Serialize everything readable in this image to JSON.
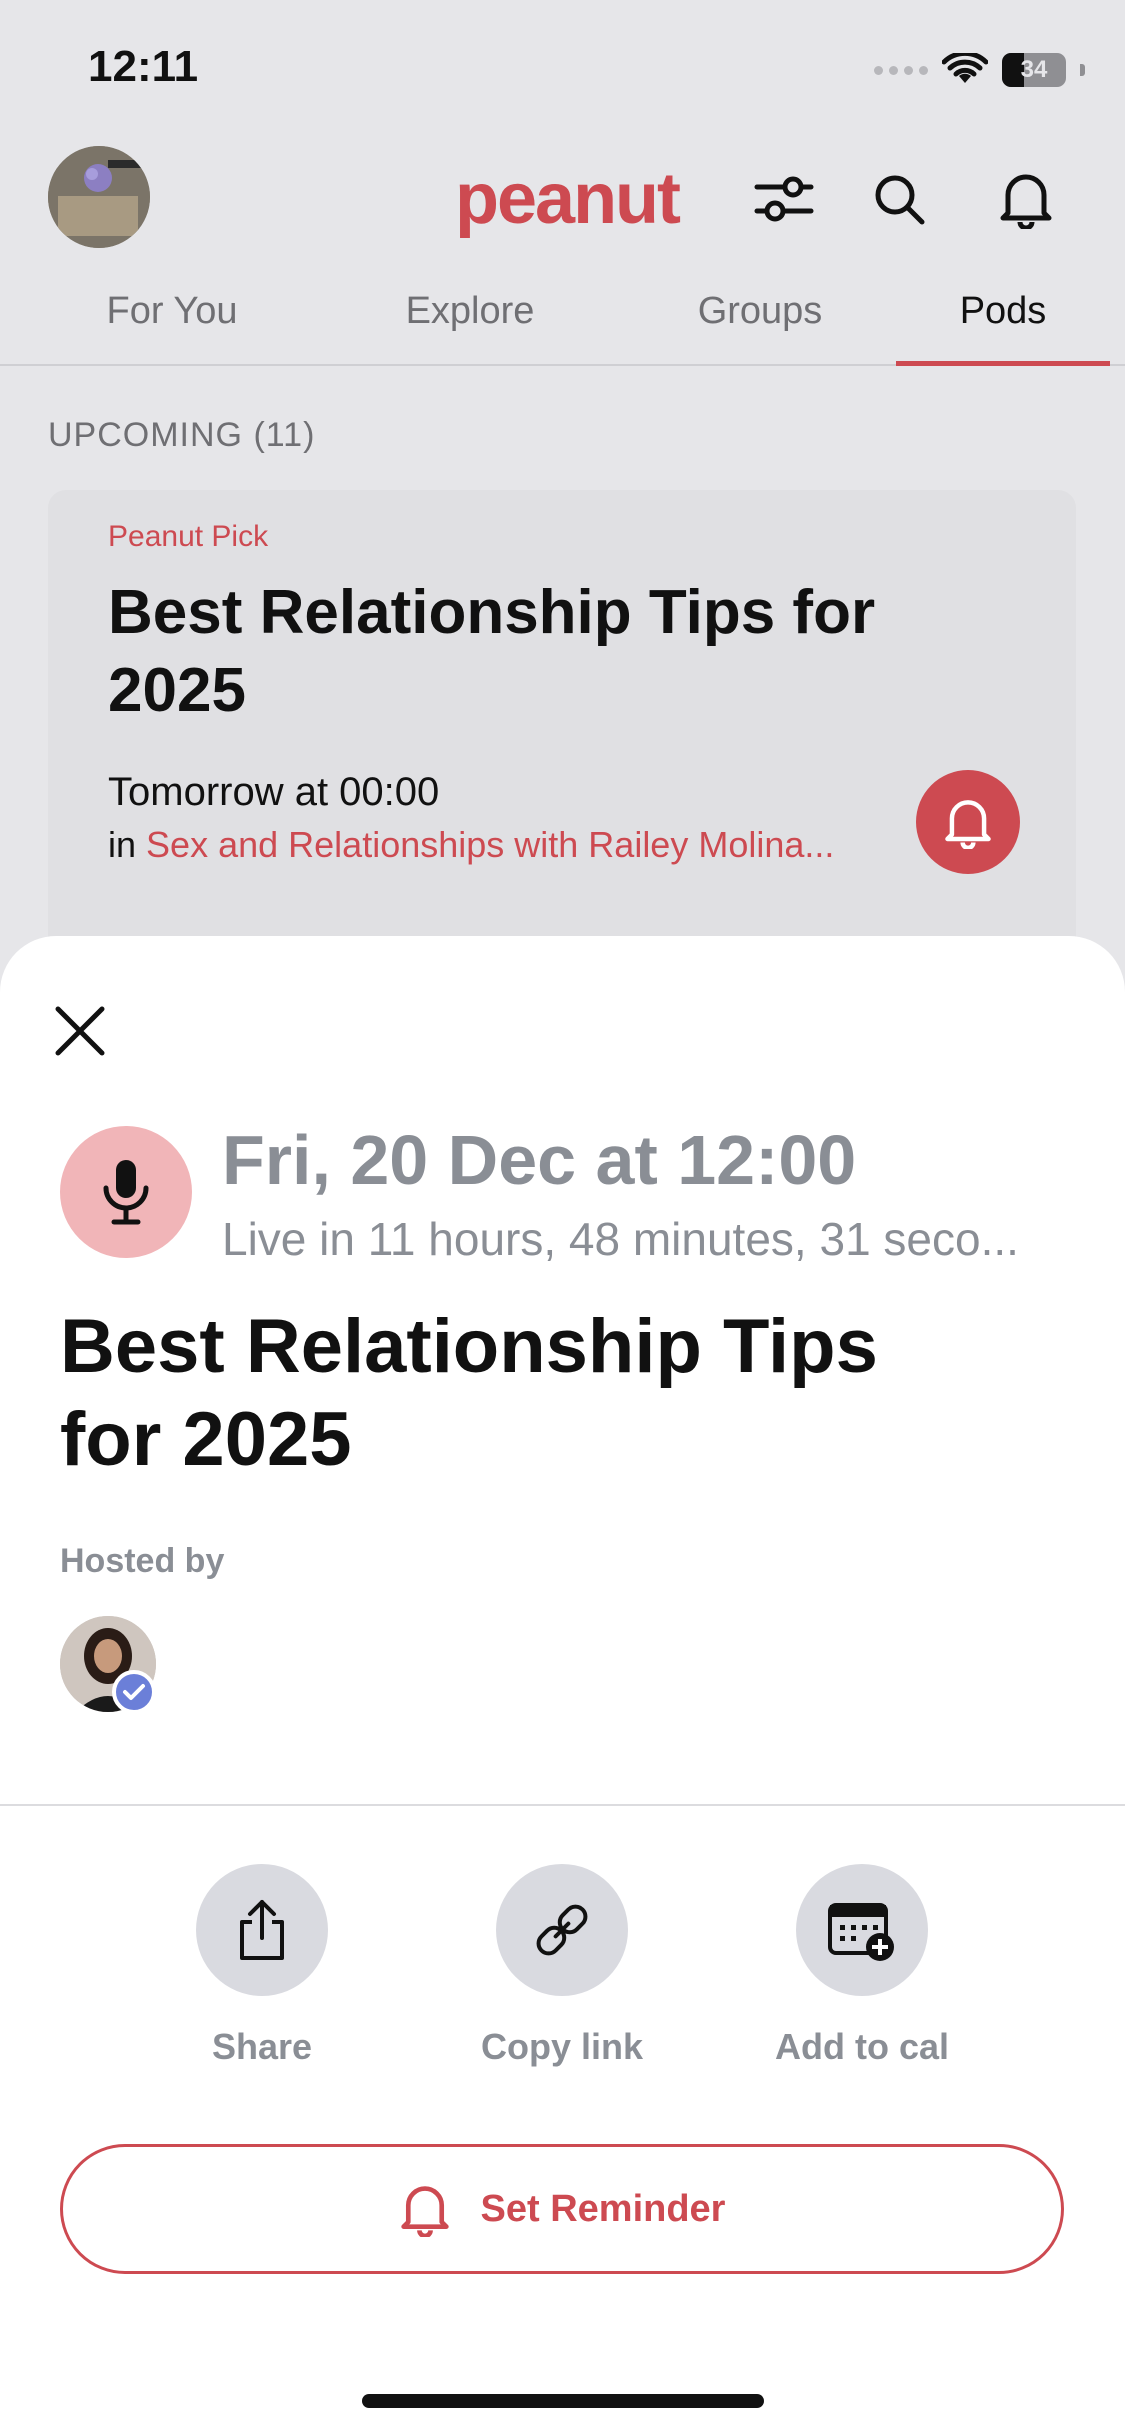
{
  "status_bar": {
    "time": "12:11",
    "battery": "34"
  },
  "header": {
    "logo": "peanut",
    "icons": [
      "filter-icon",
      "search-icon",
      "bell-icon"
    ]
  },
  "tabs": [
    {
      "label": "For You"
    },
    {
      "label": "Explore"
    },
    {
      "label": "Groups"
    },
    {
      "label": "Pods",
      "active": true
    }
  ],
  "list": {
    "section_label": "UPCOMING (11)",
    "card": {
      "pick_label": "Peanut Pick",
      "title": "Best Relationship Tips for 2025",
      "time": "Tomorrow at 00:00",
      "in_prefix": "in",
      "group": "Sex and Relationships with Railey Molina..."
    }
  },
  "sheet": {
    "date": "Fri, 20 Dec at 12:00",
    "countdown": "Live in 11 hours, 48 minutes, 31 seco...",
    "title": "Best Relationship Tips for 2025",
    "hosted_by_label": "Hosted by",
    "actions": [
      {
        "label": "Share",
        "icon": "share-icon"
      },
      {
        "label": "Copy link",
        "icon": "link-icon"
      },
      {
        "label": "Add to cal",
        "icon": "calendar-add-icon"
      }
    ],
    "reminder_label": "Set Reminder"
  },
  "colors": {
    "brand": "#cd4a51",
    "muted": "#8a8e95",
    "action_bg": "#d9dae0",
    "mic_bg": "#f1b5b8",
    "verified": "#6b7fd8"
  }
}
